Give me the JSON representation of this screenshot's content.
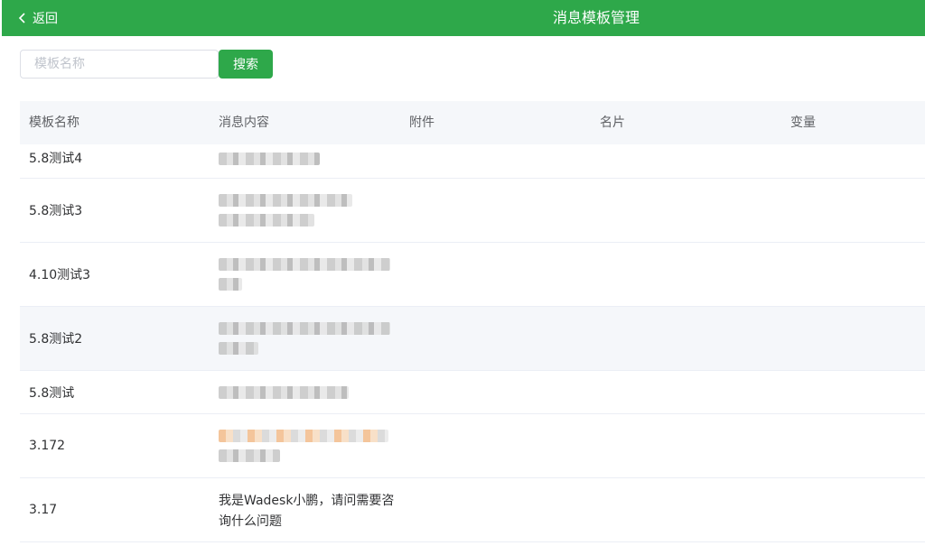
{
  "header": {
    "back_label": "返回",
    "title": "消息模板管理"
  },
  "search": {
    "placeholder": "模板名称",
    "button_label": "搜索"
  },
  "table": {
    "columns": [
      "模板名称",
      "消息内容",
      "附件",
      "名片",
      "变量"
    ],
    "rows": [
      {
        "name": "5.8测试4",
        "content": ""
      },
      {
        "name": "5.8测试3",
        "content": ""
      },
      {
        "name": "4.10测试3",
        "content": ""
      },
      {
        "name": "5.8测试2",
        "content": ""
      },
      {
        "name": "5.8测试",
        "content": ""
      },
      {
        "name": "3.172",
        "content": ""
      },
      {
        "name": "3.17",
        "content": "我是Wadesk小鹏，请问需要咨询什么问题"
      }
    ]
  },
  "colors": {
    "accent": "#2ea84a",
    "header_bg": "#f5f7fa",
    "border": "#ebeef5"
  }
}
